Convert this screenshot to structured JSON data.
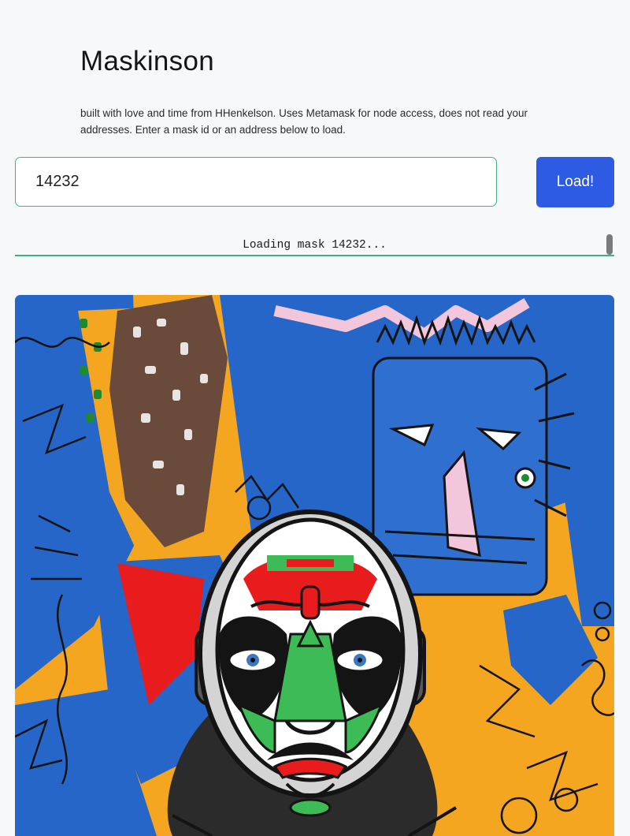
{
  "header": {
    "title": "Maskinson",
    "description": "built with love and time from HHenkelson. Uses Metamask for node access, does not read your addresses. Enter a mask id or an address below to load."
  },
  "search": {
    "value": "14232",
    "button_label": "Load!"
  },
  "status": {
    "text": "Loading mask 14232..."
  },
  "artwork": {
    "icon": "mask-artwork-image",
    "colors": {
      "orange": "#f4a620",
      "blue": "#2766c9",
      "red": "#e81c1c",
      "green": "#3dbb56",
      "black": "#141414",
      "white": "#ffffff"
    }
  }
}
